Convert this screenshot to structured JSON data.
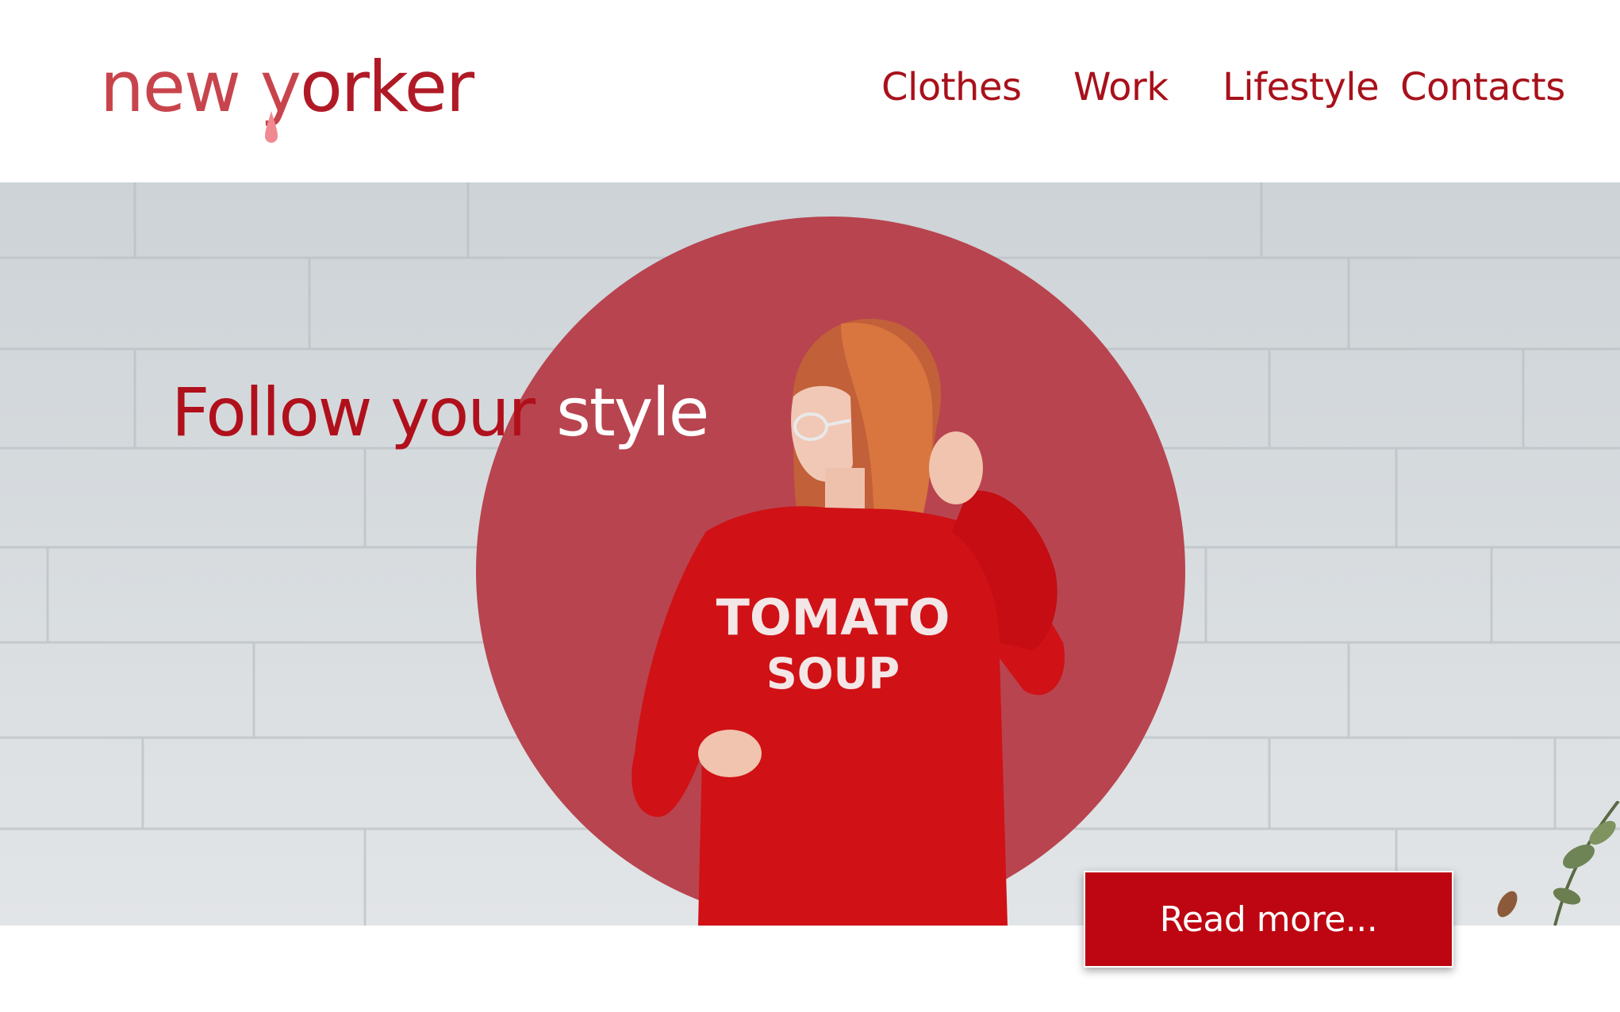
{
  "brand": {
    "logo_part1": "new y",
    "logo_part2": "orker"
  },
  "nav": {
    "items": [
      {
        "label": "Clothes"
      },
      {
        "label": "Work"
      },
      {
        "label": "Lifestyle"
      },
      {
        "label": "Contacts"
      }
    ]
  },
  "hero": {
    "headline_part1": "Follow your",
    "headline_part2": "style",
    "shirt_line1": "TOMATO",
    "shirt_line2": "SOUP",
    "cta_label": "Read more..."
  },
  "colors": {
    "brand_red": "#b0101b",
    "cta_red": "#bd0611",
    "circle_red": "#b8444f",
    "wall_gray": "#d3d8db"
  }
}
